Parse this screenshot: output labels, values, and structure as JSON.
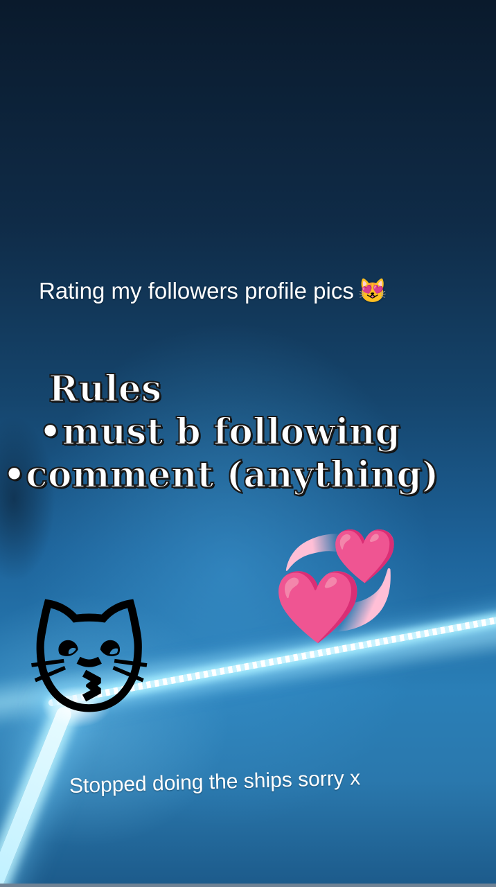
{
  "post": {
    "title": "Rating my followers profile pics",
    "title_emoji": "😻",
    "rules_heading": "Rules",
    "rules": [
      "•must b following",
      "•comment (anything)"
    ],
    "footer_note": "Stopped doing the ships sorry x"
  },
  "stickers": {
    "hearts": "💞",
    "cat": "😽"
  }
}
